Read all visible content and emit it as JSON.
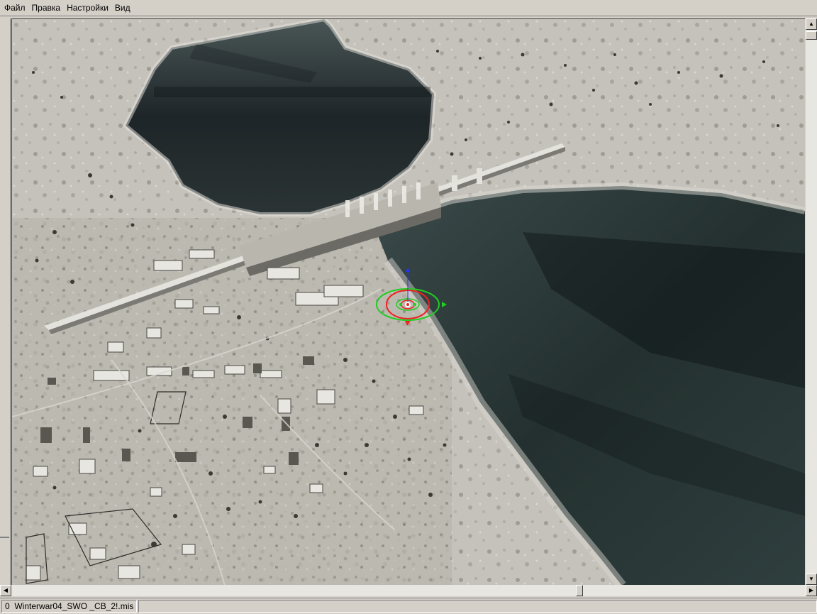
{
  "menu": {
    "items": [
      {
        "label": "Файл"
      },
      {
        "label": "Правка"
      },
      {
        "label": "Настройки"
      },
      {
        "label": "Вид"
      }
    ]
  },
  "status": {
    "text": "0  Winterwar04_SWO _CB_2!.mis"
  },
  "scrollbar": {
    "up_icon": "▲",
    "down_icon": "▼",
    "left_icon": "◀",
    "right_icon": "▶"
  },
  "scene": {
    "description_icon": "map-3d-view",
    "colors": {
      "snow": "#c9c7c0",
      "water": "#2c3a3a",
      "water_dark": "#1c2428",
      "selection_ring_green": "#22cc22",
      "selection_ring_red": "#ee2222",
      "selection_axis_blue": "#2233ff"
    }
  }
}
